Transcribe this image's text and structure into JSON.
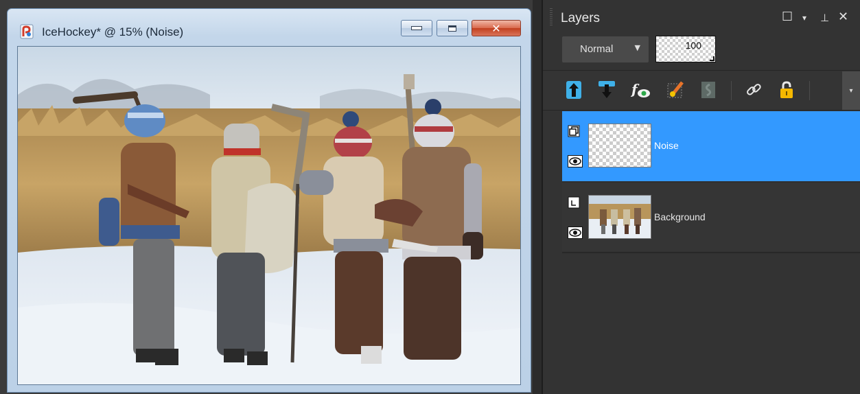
{
  "document_window": {
    "title": "IceHockey* @  15% (Noise)",
    "icon": "paintshop-app-icon",
    "controls": [
      "minimize-icon",
      "maximize-icon",
      "close-icon"
    ],
    "canvas_image": "photo of four kids with hockey sticks and skates walking through snow",
    "close_color": "#c8462a",
    "frame_color": "#c3d6ea"
  },
  "layers_panel": {
    "title": "Layers",
    "header_controls": [
      "restore-icon",
      "menu-arrow-icon",
      "pin-icon",
      "close-icon"
    ],
    "blend_mode": "Normal",
    "opacity": "100",
    "tools": [
      "move-layer-up-icon",
      "move-layer-down-icon",
      "layer-effects-icon",
      "fx-brush-icon",
      "mask-icon",
      "link-icon",
      "lock-icon"
    ],
    "selection_color": "#3399ff",
    "layers": [
      {
        "name": "Noise",
        "selected": true,
        "visible": true,
        "thumbnail": "transparent"
      },
      {
        "name": "Background",
        "selected": false,
        "visible": true,
        "thumbnail": "photo"
      }
    ]
  }
}
